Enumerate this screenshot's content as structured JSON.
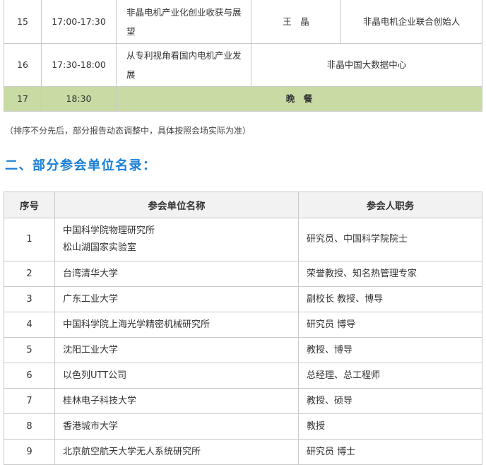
{
  "schedule": {
    "rows": [
      {
        "no": "15",
        "time": "17:00-17:30",
        "topic": "非晶电机产业化创业收获与展望",
        "speaker": "王　晶",
        "affiliation": "非晶电机企业联合创始人"
      },
      {
        "no": "16",
        "time": "17:30-18:00",
        "topic": "从专利视角看国内电机产业发展",
        "speaker_affiliation": "非晶中国大数据中心"
      },
      {
        "no": "17",
        "time": "18:30",
        "event": "晚　餐"
      }
    ],
    "note": "（排序不分先后，部分报告动态调整中，具体按照会场实际为准）"
  },
  "section": {
    "title": "二、部分参会单位名录："
  },
  "orgs": {
    "headers": [
      "序号",
      "参会单位名称",
      "参会人职务"
    ],
    "rows": [
      {
        "no": "1",
        "name_lines": [
          "中国科学院物理研究所",
          "松山湖国家实验室"
        ],
        "position": "研究员、中国科学院院士"
      },
      {
        "no": "2",
        "name_lines": [
          "台湾清华大学"
        ],
        "position": "荣誉教授、知名热管理专家"
      },
      {
        "no": "3",
        "name_lines": [
          "广东工业大学"
        ],
        "position": "副校长 教授、博导"
      },
      {
        "no": "4",
        "name_lines": [
          "中国科学院上海光学精密机械研究所"
        ],
        "position": "研究员 博导"
      },
      {
        "no": "5",
        "name_lines": [
          "沈阳工业大学"
        ],
        "position": "教授、博导"
      },
      {
        "no": "6",
        "name_lines": [
          "以色列UTT公司"
        ],
        "position": "总经理、总工程师"
      },
      {
        "no": "7",
        "name_lines": [
          "桂林电子科技大学"
        ],
        "position": "教授、硕导"
      },
      {
        "no": "8",
        "name_lines": [
          "香港城市大学"
        ],
        "position": "教授"
      },
      {
        "no": "9",
        "name_lines": [
          "北京航空航天大学无人系统研究所"
        ],
        "position": "研究员 博士"
      }
    ]
  },
  "colors": {
    "accent": "#1a7fd6",
    "dinner_row": "#c8dba4",
    "header_bg": "#f2f2f2",
    "border": "#c9c9c9"
  }
}
